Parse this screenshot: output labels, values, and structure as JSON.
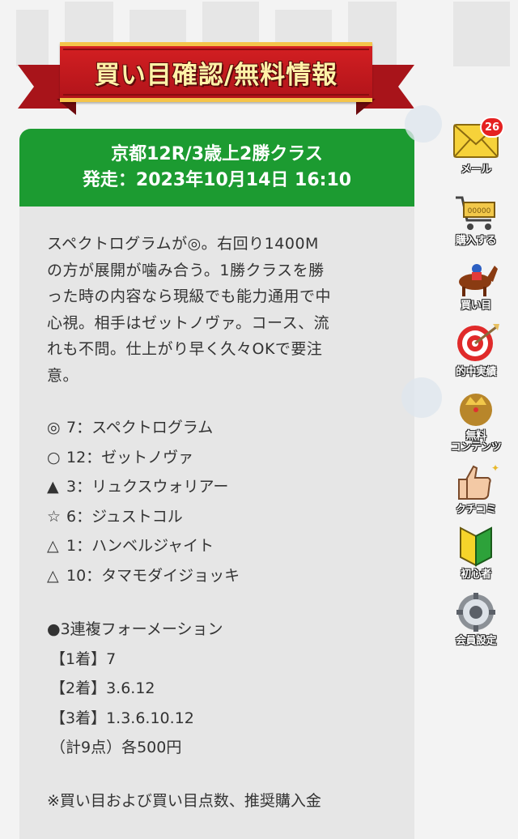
{
  "ribbon": {
    "title": "買い目確認/無料情報"
  },
  "race": {
    "title": "京都12R/3歳上2勝クラス",
    "start_time": "発走：2023年10月14日 16:10"
  },
  "comment_lines": [
    "スペクトログラムが◎。右回り1400M",
    "の方が展開が噛み合う。1勝クラスを勝",
    "った時の内容なら現級でも能力通用で中",
    "心視。相手はゼットノヴァ。コース、流",
    "れも不問。仕上がり早く久々OKで要注",
    "意。"
  ],
  "picks": [
    {
      "mark": "◎",
      "text": "7：スペクトログラム"
    },
    {
      "mark": "○",
      "text": "12：ゼットノヴァ"
    },
    {
      "mark": "▲",
      "text": "3：リュクスウォリアー"
    },
    {
      "mark": "☆",
      "text": "6：ジュストコル"
    },
    {
      "mark": "△",
      "text": "1：ハンベルジャイト"
    },
    {
      "mark": "△",
      "text": "10：タマモダイジョッキ"
    }
  ],
  "bets": {
    "type": "●3連複フォーメーション",
    "rows": [
      "【1着】7",
      "【2着】3.6.12",
      "【3着】1.3.6.10.12"
    ],
    "total": "（計9点）各500円"
  },
  "note": "※買い目および買い目点数、推奨購入金",
  "sidebar": [
    {
      "icon": "mail-icon",
      "label": "メール",
      "badge": "26"
    },
    {
      "icon": "cart-icon",
      "label": "購入する"
    },
    {
      "icon": "horse-icon",
      "label": "買い目"
    },
    {
      "icon": "target-icon",
      "label": "的中実績"
    },
    {
      "icon": "free-content-icon",
      "label": "無料\nコンテンツ"
    },
    {
      "icon": "thumbs-up-icon",
      "label": "クチコミ"
    },
    {
      "icon": "beginner-icon",
      "label": "初心者"
    },
    {
      "icon": "settings-icon",
      "label": "会員設定"
    }
  ],
  "colors": {
    "header_green": "#1c9b31",
    "ribbon_red": "#c41a1f",
    "ribbon_gold": "#f4c44a",
    "badge_red": "#e52121"
  }
}
